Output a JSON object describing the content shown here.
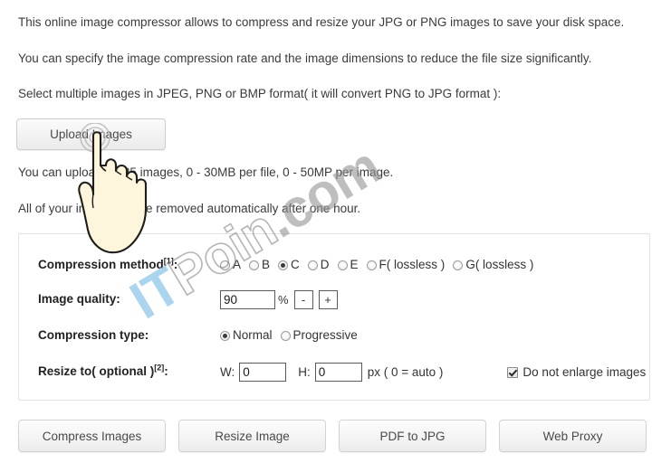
{
  "intro": {
    "lines": [
      "This online image compressor allows to compress and resize your JPG or PNG images to save your disk space.",
      "You can specify the image compression rate and the image dimensions to reduce the file size significantly.",
      "Select multiple images in JPEG, PNG or BMP format( it will convert PNG to JPG format ):"
    ]
  },
  "upload": {
    "button_label": "Upload Images"
  },
  "notes": {
    "lines": [
      "You can upload 1 - 25 images, 0 - 30MB per file, 0 - 50MP per image.",
      "All of your images will be removed automatically after one hour."
    ]
  },
  "options": {
    "compression_method": {
      "label": "Compression method",
      "footnote": "[1]",
      "suffix": ":",
      "selected": "C",
      "options": [
        {
          "value": "A",
          "label": "A",
          "checked": false
        },
        {
          "value": "B",
          "label": "B",
          "checked": false
        },
        {
          "value": "C",
          "label": "C",
          "checked": true
        },
        {
          "value": "D",
          "label": "D",
          "checked": false
        },
        {
          "value": "E",
          "label": "E",
          "checked": false
        },
        {
          "value": "F",
          "label": "F( lossless )",
          "checked": false
        },
        {
          "value": "G",
          "label": "G( lossless )",
          "checked": false
        }
      ]
    },
    "image_quality": {
      "label": "Image quality",
      "suffix": ":",
      "value": "90",
      "unit": "%",
      "decrement_label": "-",
      "increment_label": "+"
    },
    "compression_type": {
      "label": "Compression type",
      "suffix": ":",
      "selected": "Normal",
      "options": [
        {
          "value": "Normal",
          "label": "Normal",
          "checked": true
        },
        {
          "value": "Progressive",
          "label": "Progressive",
          "checked": false
        }
      ]
    },
    "resize": {
      "label": "Resize to( optional )",
      "footnote": "[2]",
      "suffix": ":",
      "width_label": "W:",
      "width_value": "0",
      "height_label": "H:",
      "height_value": "0",
      "unit_hint": "px ( 0 = auto )",
      "no_enlarge_label": "Do not enlarge images",
      "no_enlarge_checked": true
    }
  },
  "actions": {
    "buttons": [
      "Compress Images",
      "Resize Image",
      "PDF to JPG",
      "Web Proxy"
    ]
  },
  "watermark": {
    "part1": "IT",
    "part2": "Poin",
    "part3": ".com"
  },
  "colors": {
    "page_background": "#ffffff",
    "text": "#333333",
    "panel_border": "#e2e2e2",
    "button_face": "#f3f3f3",
    "watermark_blue": "#96cAEB",
    "watermark_gray": "#969696"
  }
}
